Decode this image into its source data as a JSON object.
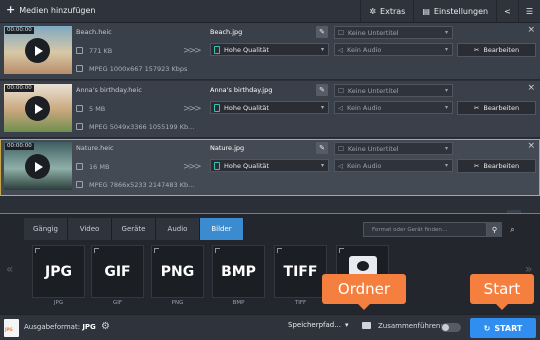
{
  "toolbar": {
    "add_media": "Medien hinzufügen",
    "extras": "Extras",
    "settings": "Einstellungen"
  },
  "files": [
    {
      "duration": "00:00:00",
      "source_name": "Beach.heic",
      "size": "771 KB",
      "info": "MPEG 1000x667 157923 Kbps",
      "output_name": "Beach.jpg",
      "quality": "Hohe Qualität",
      "subtitle": "Keine Untertitel",
      "audio": "Kein Audio",
      "edit": "Bearbeiten",
      "thumb_colors": [
        "#7fa9c3",
        "#d8c8a6",
        "#b88d6a"
      ]
    },
    {
      "duration": "00:00:00",
      "source_name": "Anna's birthday.heic",
      "size": "5 MB",
      "info": "MPEG 5049x3366 1055199 Kb...",
      "output_name": "Anna's birthday.jpg",
      "quality": "Hohe Qualität",
      "subtitle": "Keine Untertitel",
      "audio": "Kein Audio",
      "edit": "Bearbeiten",
      "thumb_colors": [
        "#e9e2d5",
        "#c9a77c",
        "#6f8f4f"
      ]
    },
    {
      "duration": "00:00:00",
      "source_name": "Nature.heic",
      "size": "16 MB",
      "info": "MPEG 7866x5233 2147483 Kb...",
      "output_name": "Nature.jpg",
      "quality": "Hohe Qualität",
      "subtitle": "Keine Untertitel",
      "audio": "Kein Audio",
      "edit": "Bearbeiten",
      "thumb_colors": [
        "#3f5f63",
        "#8fb0a8",
        "#2b3d3a"
      ]
    }
  ],
  "format_panel": {
    "tabs": [
      "Gängig",
      "Video",
      "Geräte",
      "Audio",
      "Bilder"
    ],
    "active_tab": "Bilder",
    "search_placeholder": "Format oder Gerät finden...",
    "formats": [
      {
        "tile": "JPG",
        "label": "JPG"
      },
      {
        "tile": "GIF",
        "label": "GIF"
      },
      {
        "tile": "PNG",
        "label": "PNG"
      },
      {
        "tile": "BMP",
        "label": "BMP"
      },
      {
        "tile": "TIFF",
        "label": "TIFF"
      }
    ]
  },
  "callouts": {
    "folder": "Ordner",
    "start": "Start"
  },
  "bottom": {
    "output_icon_text": "JPG",
    "output_format_label": "Ausgabeformat:",
    "output_format_value": "JPG",
    "save_path": "Speicherpfad...",
    "merge_label": "Zusammenführen:",
    "start": "START"
  },
  "colors": {
    "accent": "#3a8bd0",
    "start": "#2f8ef0",
    "callout": "#f57f3f",
    "selection": "#c9a544"
  }
}
